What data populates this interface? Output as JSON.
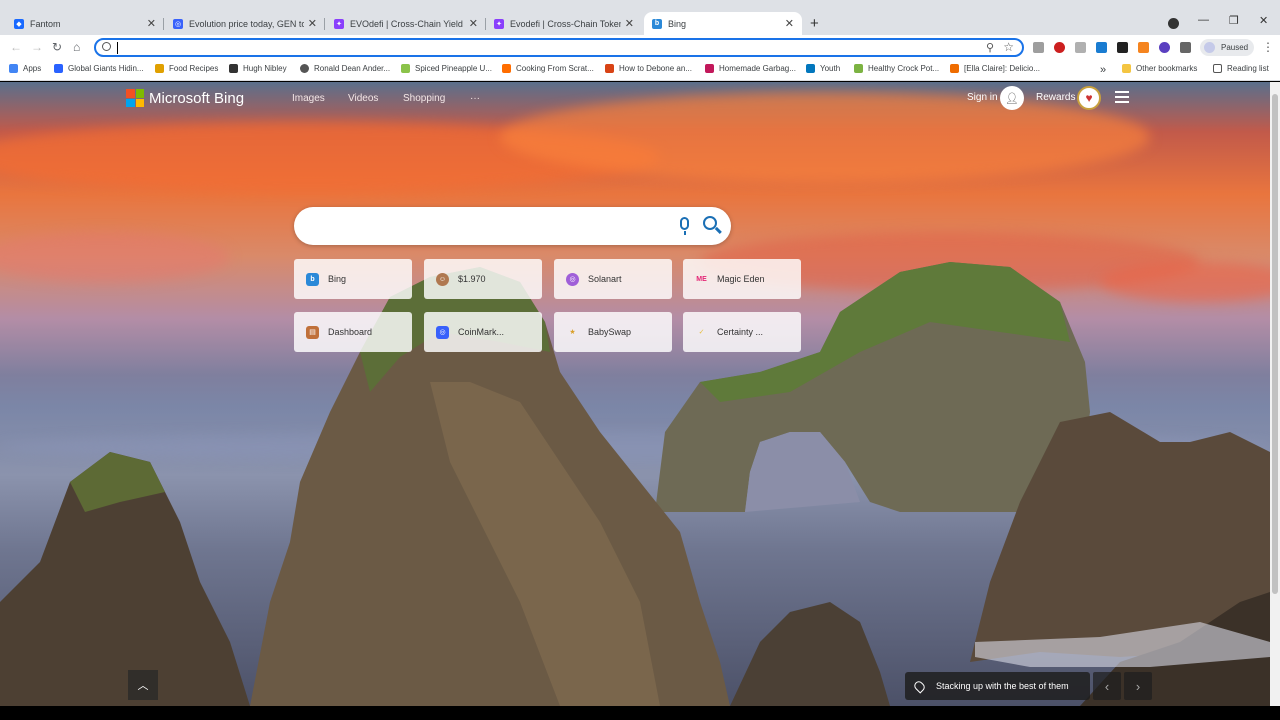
{
  "browser": {
    "tabs": [
      {
        "title": "Fantom",
        "fav_color": "#1969ff",
        "fav_glyph": "◆"
      },
      {
        "title": "Evolution price today, GEN to USD",
        "fav_color": "#3861fb",
        "fav_glyph": "◎"
      },
      {
        "title": "EVOdefi | Cross-Chain Yield Farm",
        "fav_color": "#8a3ffc",
        "fav_glyph": "✦"
      },
      {
        "title": "Evodefi | Cross-Chain Token Bridge",
        "fav_color": "#8a3ffc",
        "fav_glyph": "✦"
      },
      {
        "title": "Bing",
        "fav_color": "#2b89d8",
        "fav_glyph": "b",
        "active": true
      }
    ],
    "new_tab_icon": "plus-icon",
    "window_controls": {
      "minimize": "—",
      "maximize": "❐",
      "close": "✕"
    },
    "profile_status": "Paused",
    "address_value": "",
    "bookmarks": [
      {
        "label": "Apps",
        "color": "#4285f4"
      },
      {
        "label": "Global Giants Hidin...",
        "color": "#2962ff"
      },
      {
        "label": "Food Recipes",
        "color": "#e0a000"
      },
      {
        "label": "Hugh Nibley",
        "color": "#333333"
      },
      {
        "label": "Ronald Dean Ander...",
        "color": "#555555"
      },
      {
        "label": "Spiced Pineapple U...",
        "color": "#8bc34a"
      },
      {
        "label": "Cooking From Scrat...",
        "color": "#ff6d00"
      },
      {
        "label": "How to Debone an...",
        "color": "#d84315"
      },
      {
        "label": "Homemade Garbag...",
        "color": "#c2185b"
      },
      {
        "label": "Youth",
        "color": "#0277bd"
      },
      {
        "label": "Healthy Crock Pot...",
        "color": "#7cb342"
      },
      {
        "label": "[Ella Claire]: Delicio...",
        "color": "#ef6c00"
      }
    ],
    "bookmarks_overflow": "»",
    "other_bookmarks": "Other bookmarks",
    "reading_list": "Reading list"
  },
  "bing": {
    "logo_text": "Microsoft Bing",
    "nav": [
      "Images",
      "Videos",
      "Shopping",
      "···"
    ],
    "sign_in": "Sign in",
    "rewards": "Rewards",
    "search_placeholder": "",
    "tiles": [
      {
        "label": "Bing",
        "color": "#2b89d8",
        "glyph": "b"
      },
      {
        "label": "$1.970",
        "color": "#b07850",
        "glyph": "☺"
      },
      {
        "label": "Solanart",
        "color": "#a05fd8",
        "glyph": "◎"
      },
      {
        "label": "Magic Eden",
        "color": "#e42575",
        "glyph": "ME"
      },
      {
        "label": "Dashboard",
        "color": "#c0703a",
        "glyph": "▤"
      },
      {
        "label": "CoinMark...",
        "color": "#3861fb",
        "glyph": "◎"
      },
      {
        "label": "BabySwap",
        "color": "#d9a02a",
        "glyph": "★"
      },
      {
        "label": "Certainty ...",
        "color": "#e8c040",
        "glyph": "✓"
      }
    ],
    "caption": "Stacking up with the best of them",
    "prev_arrow": "‹",
    "next_arrow": "›",
    "scroll_up": "︿"
  },
  "colors": {
    "accent": "#1a73e8",
    "bing_blue": "#1a6fb5"
  }
}
